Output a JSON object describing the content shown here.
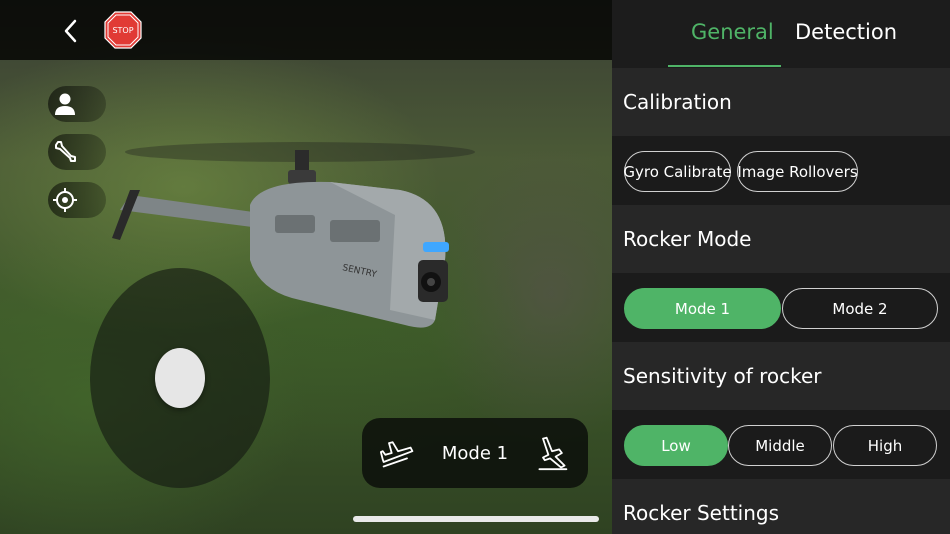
{
  "topbar": {
    "back_icon": "chevron-left-icon",
    "stop_icon": "stop-sign-icon",
    "stop_label": "STOP"
  },
  "side_tools": [
    {
      "icon": "person-icon"
    },
    {
      "icon": "wrench-icon"
    },
    {
      "icon": "crosshair-icon"
    }
  ],
  "drone_text": {
    "brand": "SENTRY"
  },
  "mode_bar": {
    "label": "Mode 1",
    "left_icon": "takeoff-icon",
    "right_icon": "landing-icon"
  },
  "tabs": [
    {
      "label": "General",
      "active": true
    },
    {
      "label": "Detection",
      "active": false
    }
  ],
  "sections": {
    "calibration": {
      "title": "Calibration",
      "buttons": [
        "Gyro Calibrate",
        "Image Rollovers"
      ]
    },
    "rocker_mode": {
      "title": "Rocker Mode",
      "options": [
        "Mode 1",
        "Mode 2"
      ],
      "selected": "Mode 1"
    },
    "sensitivity": {
      "title": "Sensitivity of rocker",
      "options": [
        "Low",
        "Middle",
        "High"
      ],
      "selected": "Low"
    },
    "rocker_settings": {
      "title": "Rocker Settings"
    }
  },
  "colors": {
    "accent": "#4fb467",
    "panel_bg": "#1a1a1a",
    "section_bg": "#272727",
    "stop_red": "#e13a35"
  }
}
